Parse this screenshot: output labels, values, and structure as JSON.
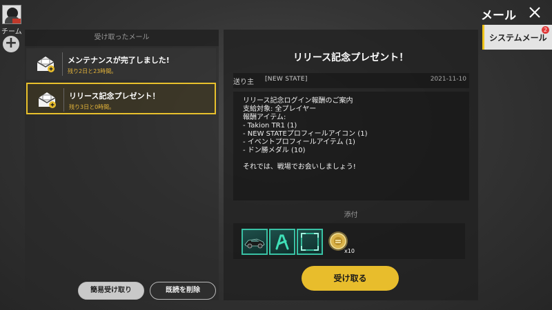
{
  "sidebar": {
    "team_label": "チーム",
    "add_symbol": "+"
  },
  "header": {
    "title": "メール",
    "close_symbol": "✕"
  },
  "tabs": [
    {
      "label": "システムメール",
      "badge": "2",
      "selected": true
    }
  ],
  "mail_list": {
    "header": "受け取ったメール",
    "items": [
      {
        "subject": "メンテナンスが完了しました!",
        "expiry": "残り2日と23時間。",
        "icon": "envelope-icon",
        "selected": false
      },
      {
        "subject": "リリース記念プレゼント！",
        "expiry": "残り3日と0時間。",
        "icon": "envelope-icon",
        "selected": true
      }
    ],
    "quick_receive_label": "簡易受け取り",
    "delete_read_label": "既読を削除"
  },
  "detail": {
    "title": "リリース記念プレゼント！",
    "sender_label": "送り主",
    "sender_name": "[NEW STATE]",
    "date": "2021-11-10",
    "body_lines": [
      "リリース記念ログイン報酬のご案内",
      "支給対象: 全プレイヤー",
      "報酬アイテム:",
      "- Takion TR1 (1)",
      "- NEW STATEプロフィールアイコン (1)",
      "- イベントプロフィールアイテム (1)",
      "- ドン勝メダル (10)",
      "",
      "それでは、戦場でお会いしましょう!"
    ],
    "attachments_label": "添付",
    "attachments": [
      {
        "icon": "vehicle-icon"
      },
      {
        "icon": "profile-icon"
      },
      {
        "icon": "frame-icon"
      },
      {
        "icon": "medal-icon",
        "quantity": "x10"
      }
    ],
    "claim_label": "受け取る"
  },
  "colors": {
    "accent": "#e8bd2c",
    "teal": "#39c2a5",
    "badge": "#e03b3b"
  }
}
